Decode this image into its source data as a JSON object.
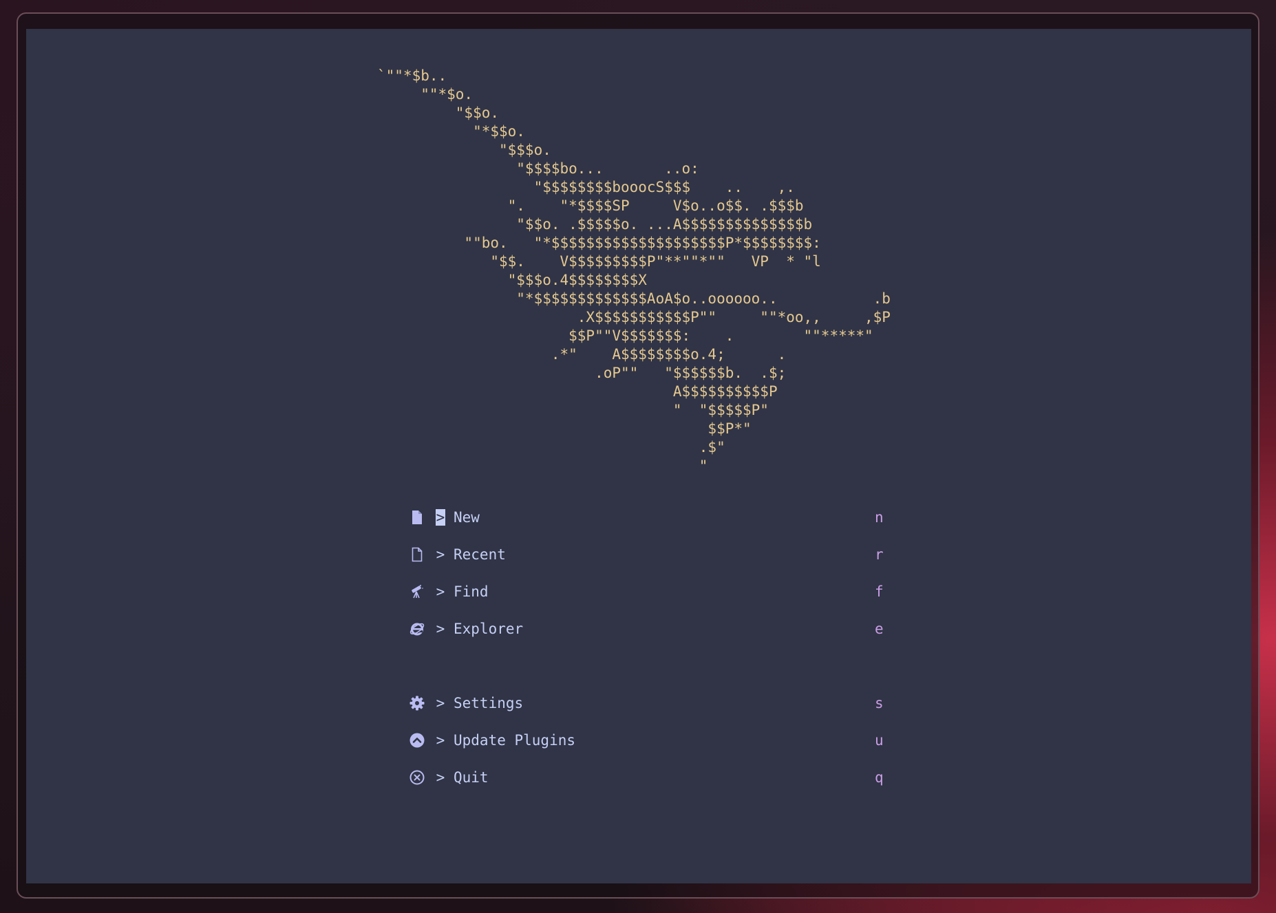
{
  "colors": {
    "background": "#303446",
    "art": "#e5c890",
    "text": "#c6d0f5",
    "key": "#ca9ee6",
    "icon": "#babbf1"
  },
  "header": {
    "ascii_art": "`\"\"*$b..\n     \"\"*$o.\n         \"$$o.\n           \"*$$o.\n              \"$$$o.\n                \"$$$$bo...       ..o:\n                  \"$$$$$$$$booocS$$$    ..    ,.\n               \".    \"*$$$$SP     V$o..o$$. .$$$b\n                \"$$o. .$$$$$o. ...A$$$$$$$$$$$$$$b\n          \"\"bo.   \"*$$$$$$$$$$$$$$$$$$$$P*$$$$$$$$:\n             \"$$.    V$$$$$$$$$P\"**\"\"*\"\"   VP  * \"l\n               \"$$$o.4$$$$$$$$X\n                \"*$$$$$$$$$$$$$AoA$o..oooooo..           .b\n                       .X$$$$$$$$$$$P\"\"     \"\"*oo,,     ,$P\n                      $$P\"\"V$$$$$$$:    .        \"\"*****\"\n                    .*\"    A$$$$$$$$o.4;      .\n                         .oP\"\"   \"$$$$$$b.  .$;\n                                  A$$$$$$$$$$P\n                                  \"  \"$$$$$P\"\n                                      $$P*\"\n                                     .$\"\n                                     \""
  },
  "menu": {
    "items": [
      {
        "icon": "file-filled-icon",
        "arrow": ">",
        "label": "New",
        "key": "n"
      },
      {
        "icon": "file-outline-icon",
        "arrow": ">",
        "label": "Recent",
        "key": "r"
      },
      {
        "icon": "telescope-icon",
        "arrow": ">",
        "label": "Find",
        "key": "f"
      },
      {
        "icon": "internet-explorer-icon",
        "arrow": ">",
        "label": "Explorer",
        "key": "e"
      },
      {
        "icon": "gear-icon",
        "arrow": ">",
        "label": "Settings",
        "key": "s"
      },
      {
        "icon": "arrow-up-circle-icon",
        "arrow": ">",
        "label": "Update Plugins",
        "key": "u"
      },
      {
        "icon": "close-circle-icon",
        "arrow": ">",
        "label": "Quit",
        "key": "q"
      }
    ]
  }
}
